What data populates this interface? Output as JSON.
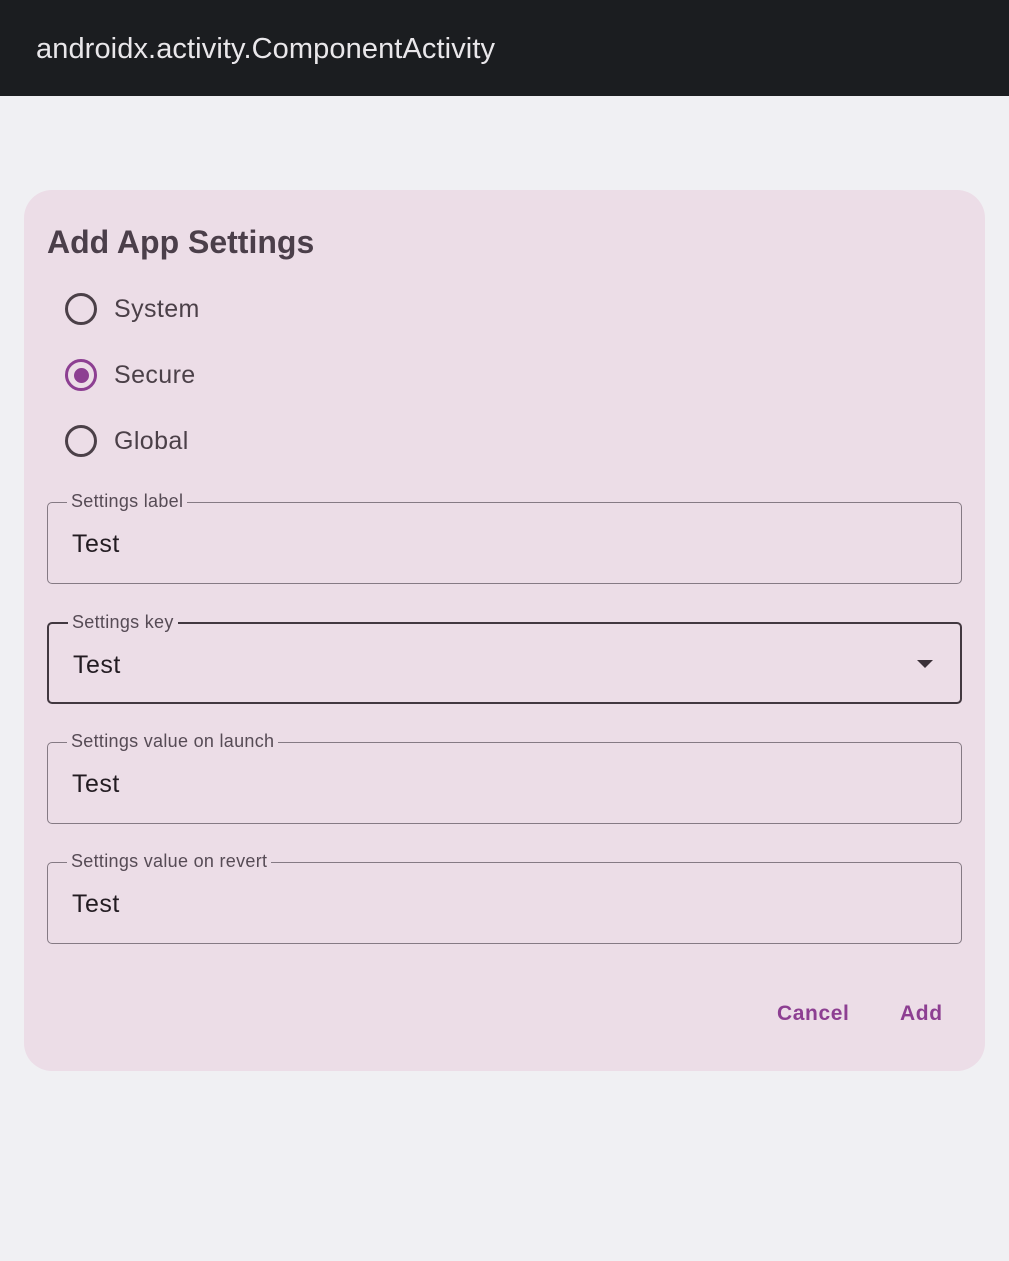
{
  "app_bar": {
    "title": "androidx.activity.ComponentActivity"
  },
  "dialog": {
    "title": "Add App Settings",
    "radio_options": [
      {
        "label": "System",
        "checked": false
      },
      {
        "label": "Secure",
        "checked": true
      },
      {
        "label": "Global",
        "checked": false
      }
    ],
    "fields": {
      "settings_label": {
        "label": "Settings label",
        "value": "Test"
      },
      "settings_key": {
        "label": "Settings key",
        "value": "Test"
      },
      "value_on_launch": {
        "label": "Settings value on launch",
        "value": "Test"
      },
      "value_on_revert": {
        "label": "Settings value on revert",
        "value": "Test"
      }
    },
    "buttons": {
      "cancel": "Cancel",
      "add": "Add"
    }
  },
  "colors": {
    "app_bar_bg": "#1b1d20",
    "background": "#f0f0f3",
    "dialog_bg": "#ecdde7",
    "accent": "#8d3f92"
  },
  "icons": {
    "dropdown": "arrow-drop-down-icon"
  }
}
